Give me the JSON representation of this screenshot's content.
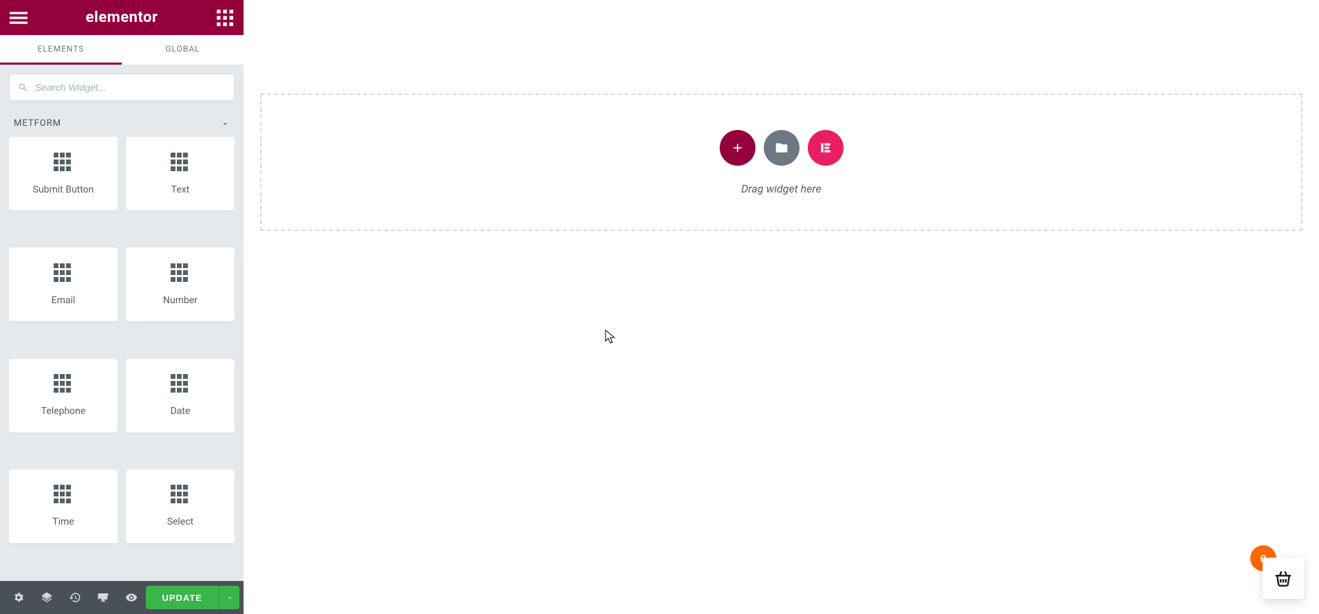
{
  "brand": "elementor",
  "tabs": {
    "elements": "ELEMENTS",
    "global": "GLOBAL"
  },
  "search": {
    "placeholder": "Search Widget..."
  },
  "category": {
    "name": "METFORM"
  },
  "widgets": [
    {
      "label": "Submit Button"
    },
    {
      "label": "Text"
    },
    {
      "label": "Email"
    },
    {
      "label": "Number"
    },
    {
      "label": "Telephone"
    },
    {
      "label": "Date"
    },
    {
      "label": "Time"
    },
    {
      "label": "Select"
    }
  ],
  "footer": {
    "update": "UPDATE"
  },
  "dropzone": {
    "hint": "Drag widget here"
  },
  "cart": {
    "count": "0"
  }
}
